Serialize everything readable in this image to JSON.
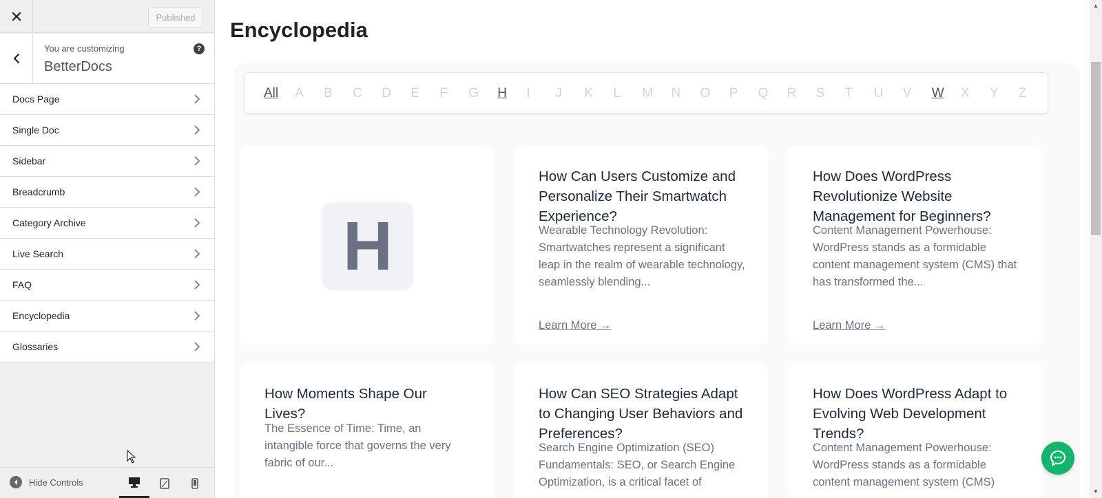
{
  "customizer": {
    "publish_label": "Published",
    "customizing_label": "You are customizing",
    "site_name": "BetterDocs",
    "sections": [
      {
        "label": "Docs Page"
      },
      {
        "label": "Single Doc"
      },
      {
        "label": "Sidebar"
      },
      {
        "label": "Breadcrumb"
      },
      {
        "label": "Category Archive"
      },
      {
        "label": "Live Search"
      },
      {
        "label": "FAQ"
      },
      {
        "label": "Encyclopedia"
      },
      {
        "label": "Glossaries"
      }
    ],
    "hide_controls_label": "Hide Controls",
    "active_device": "desktop"
  },
  "preview": {
    "page_title": "Encyclopedia",
    "alphabet": {
      "letters": [
        "All",
        "A",
        "B",
        "C",
        "D",
        "E",
        "F",
        "G",
        "H",
        "I",
        "J",
        "K",
        "L",
        "M",
        "N",
        "O",
        "P",
        "Q",
        "R",
        "S",
        "T",
        "U",
        "V",
        "W",
        "X",
        "Y",
        "Z"
      ],
      "active_letters": [
        "All",
        "H",
        "W"
      ]
    },
    "letter_tile": "H",
    "learn_more_label": "Learn More →",
    "cards": [
      {
        "title": "How Can Users Customize and Personalize Their Smartwatch Experience?",
        "excerpt": "Wearable Technology Revolution: Smartwatches represent a significant leap in the realm of wearable technology, seamlessly blending...",
        "has_learn_more": true
      },
      {
        "title": "How Does WordPress Revolutionize Website Management for Beginners?",
        "excerpt": "Content Management Powerhouse: WordPress stands as a formidable content management system (CMS) that has transformed the...",
        "has_learn_more": true
      },
      {
        "title": "How Moments Shape Our Lives?",
        "excerpt": "The Essence of Time: Time, an intangible force that governs the very fabric of our...",
        "has_learn_more": false
      },
      {
        "title": "How Can SEO Strategies Adapt to Changing User Behaviors and Preferences?",
        "excerpt": "Search Engine Optimization (SEO) Fundamentals: SEO, or Search Engine Optimization, is a critical facet of",
        "has_learn_more": false
      },
      {
        "title": "How Does WordPress Adapt to Evolving Web Development Trends?",
        "excerpt": "Content Management Powerhouse: WordPress stands as a formidable content management system (CMS)",
        "has_learn_more": false
      }
    ]
  },
  "colors": {
    "chat_button": "#16b36e",
    "text_dark": "#1d2327",
    "muted_letter": "#d1d5db"
  },
  "icons": {
    "close": "close-icon",
    "back": "chevron-left-icon",
    "help": "help-icon",
    "section_arrow": "chevron-right-icon",
    "hide_controls": "collapse-icon",
    "desktop": "desktop-icon",
    "tablet": "tablet-icon",
    "mobile": "mobile-icon",
    "chat": "chat-icon"
  }
}
